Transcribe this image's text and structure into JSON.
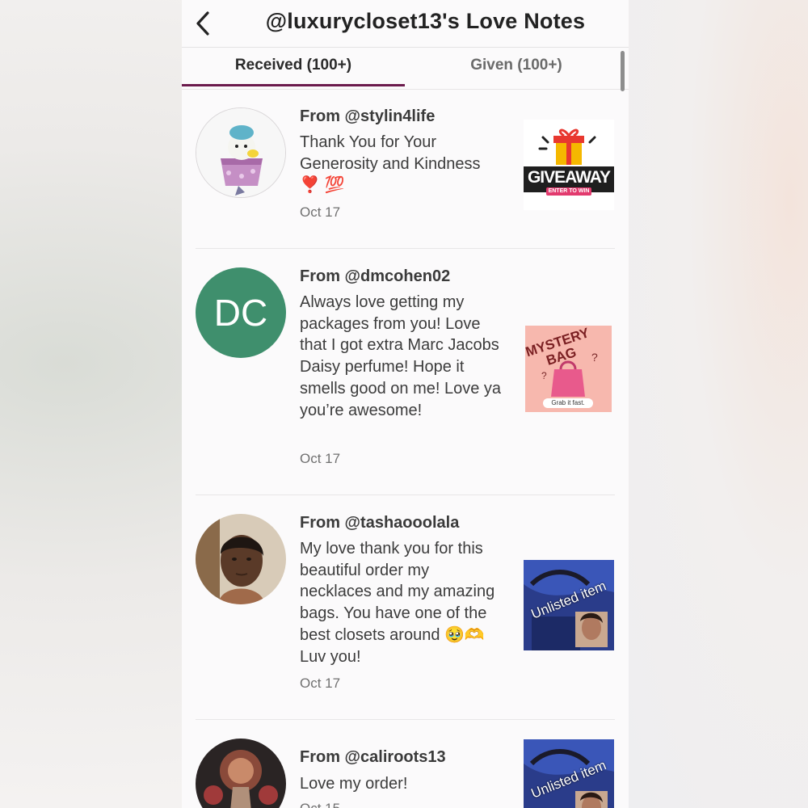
{
  "header": {
    "title": "@luxurycloset13's Love Notes",
    "back_icon": "chevron-left-icon"
  },
  "tabs": [
    {
      "label": "Received (100+)",
      "active": true
    },
    {
      "label": "Given (100+)",
      "active": false
    }
  ],
  "colors": {
    "accent": "#6b1a4c",
    "dc_avatar": "#3f8f6d"
  },
  "notes": [
    {
      "from": "From @stylin4life",
      "message": "Thank You for Your Generosity and Kindness",
      "emoji": "❣️ 💯",
      "date": "Oct 17",
      "thumb_text": "GIVEAWAY",
      "thumb_subtext": "ENTER TO WIN"
    },
    {
      "from": "From @dmcohen02",
      "initials": "DC",
      "message": "Always love getting my packages from you! Love that I got extra Marc Jacobs Daisy perfume! Hope it smells good on me! Love ya you’re awesome!",
      "date": "Oct 17",
      "thumb_text": "MYSTERY BAG",
      "thumb_subtext": "Grab it fast."
    },
    {
      "from": "From @tashaooolala",
      "message": "My love thank you for this beautiful order my necklaces and my amazing bags. You have one of the best closets around",
      "emoji": "🥹🫶",
      "message_end": "Luv you!",
      "date": "Oct 17",
      "thumb_text": "Unlisted item"
    },
    {
      "from": "From @caliroots13",
      "message": "Love my order!",
      "date": "Oct 15",
      "thumb_text": "Unlisted item"
    }
  ]
}
